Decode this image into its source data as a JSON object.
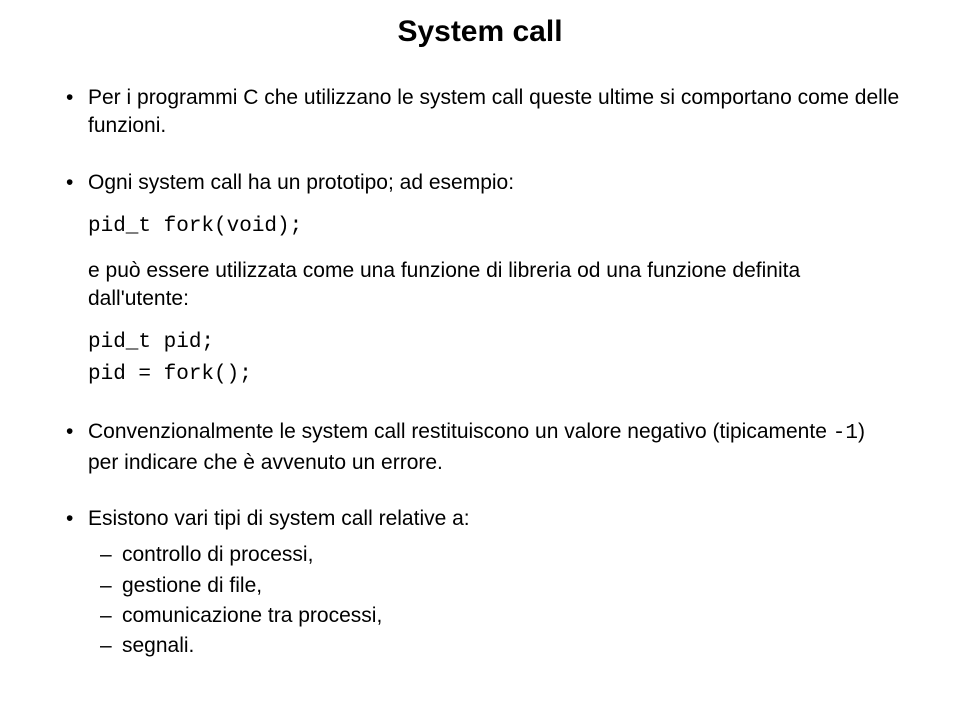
{
  "title": "System call",
  "items": [
    {
      "text": "Per i programmi C che utilizzano le system call queste ultime si comportano come delle funzioni."
    },
    {
      "pre": "Ogni system call ha un prototipo; ad esempio:",
      "code1": "pid_t fork(void);",
      "mid": "e può essere utilizzata come una funzione di libreria od una funzione definita dall'utente:",
      "code2": "pid_t pid;\npid = fork();"
    },
    {
      "pre": "Convenzionalmente le system call restituiscono un valore negativo (tipicamente ",
      "code_inline": "-1",
      "post": ") per indicare che è avvenuto un errore."
    },
    {
      "text": "Esistono vari tipi di system call relative a:",
      "sub": [
        "controllo di processi,",
        "gestione di file,",
        "comunicazione tra processi,",
        "segnali."
      ]
    }
  ]
}
